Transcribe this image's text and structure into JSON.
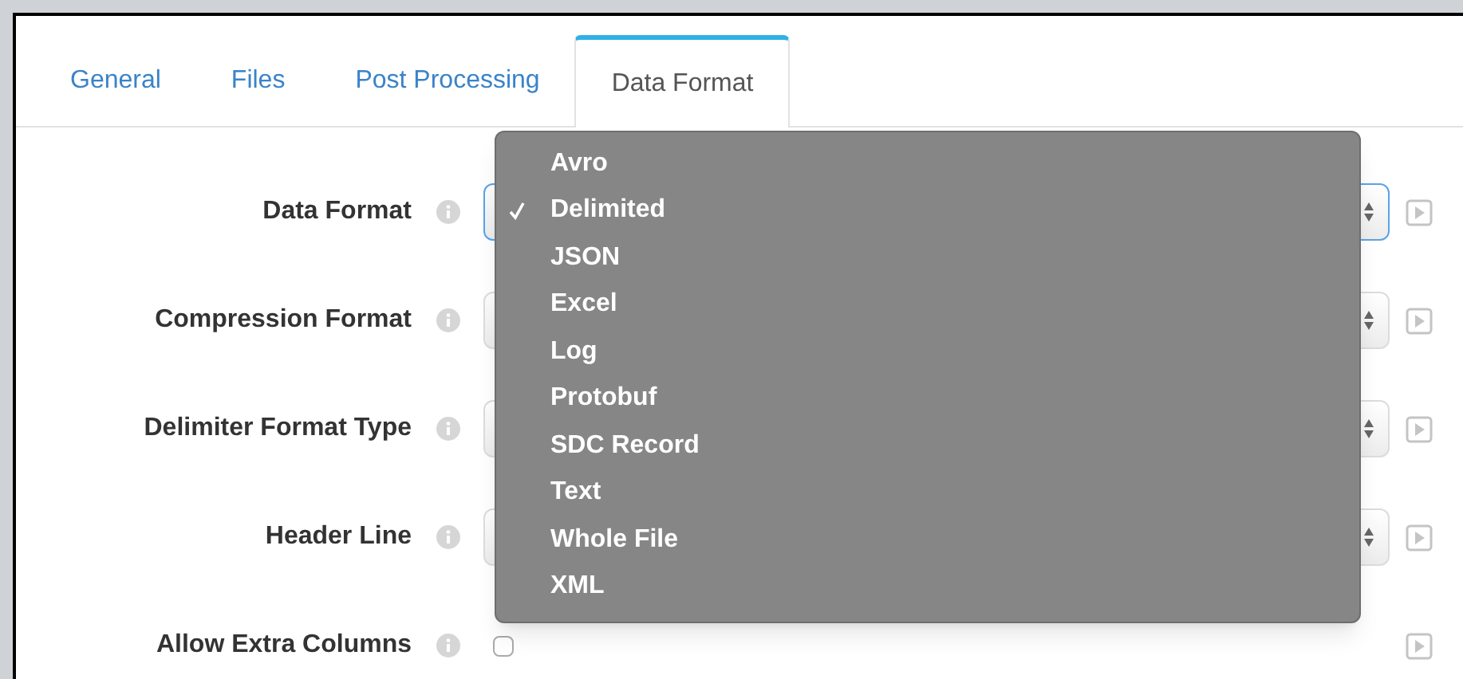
{
  "tabs": [
    {
      "label": "General",
      "selected": false
    },
    {
      "label": "Files",
      "selected": false
    },
    {
      "label": "Post Processing",
      "selected": false
    },
    {
      "label": "Data Format",
      "selected": true
    }
  ],
  "fields": [
    {
      "label": "Data Format",
      "kind": "select",
      "focused": true
    },
    {
      "label": "Compression Format",
      "kind": "select",
      "focused": false
    },
    {
      "label": "Delimiter Format Type",
      "kind": "select",
      "focused": false
    },
    {
      "label": "Header Line",
      "kind": "select",
      "focused": false
    },
    {
      "label": "Allow Extra Columns",
      "kind": "checkbox",
      "checked": false
    }
  ],
  "dropdown": {
    "options": [
      {
        "label": "Avro",
        "selected": false
      },
      {
        "label": "Delimited",
        "selected": true
      },
      {
        "label": "JSON",
        "selected": false
      },
      {
        "label": "Excel",
        "selected": false
      },
      {
        "label": "Log",
        "selected": false
      },
      {
        "label": "Protobuf",
        "selected": false
      },
      {
        "label": "SDC Record",
        "selected": false
      },
      {
        "label": "Text",
        "selected": false
      },
      {
        "label": "Whole File",
        "selected": false
      },
      {
        "label": "XML",
        "selected": false
      }
    ]
  }
}
